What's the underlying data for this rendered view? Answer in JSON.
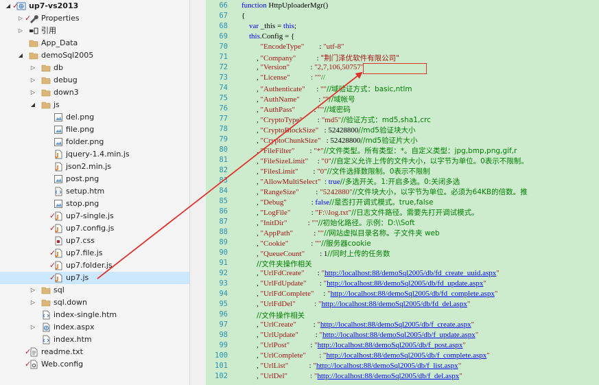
{
  "explorer": {
    "items": [
      {
        "label": "up7-vs2013",
        "depth": 0,
        "icon": "solution",
        "expand": "open",
        "checked": true,
        "root": true
      },
      {
        "label": "Properties",
        "depth": 1,
        "icon": "wrench",
        "expand": "closed",
        "checked": true
      },
      {
        "label": "引用",
        "depth": 1,
        "icon": "references",
        "expand": "closed"
      },
      {
        "label": "App_Data",
        "depth": 1,
        "icon": "folder"
      },
      {
        "label": "demoSql2005",
        "depth": 1,
        "icon": "folder",
        "expand": "open"
      },
      {
        "label": "db",
        "depth": 2,
        "icon": "folder",
        "expand": "closed"
      },
      {
        "label": "debug",
        "depth": 2,
        "icon": "folder",
        "expand": "closed"
      },
      {
        "label": "down3",
        "depth": 2,
        "icon": "folder",
        "expand": "closed"
      },
      {
        "label": "js",
        "depth": 2,
        "icon": "folder",
        "expand": "open"
      },
      {
        "label": "del.png",
        "depth": 3,
        "icon": "image"
      },
      {
        "label": "file.png",
        "depth": 3,
        "icon": "image"
      },
      {
        "label": "folder.png",
        "depth": 3,
        "icon": "image"
      },
      {
        "label": "jquery-1.4.min.js",
        "depth": 3,
        "icon": "js"
      },
      {
        "label": "json2.min.js",
        "depth": 3,
        "icon": "js"
      },
      {
        "label": "post.png",
        "depth": 3,
        "icon": "image"
      },
      {
        "label": "setup.htm",
        "depth": 3,
        "icon": "html"
      },
      {
        "label": "stop.png",
        "depth": 3,
        "icon": "image"
      },
      {
        "label": "up7-single.js",
        "depth": 3,
        "icon": "js",
        "checked": true
      },
      {
        "label": "up7.config.js",
        "depth": 3,
        "icon": "js",
        "checked": true
      },
      {
        "label": "up7.css",
        "depth": 3,
        "icon": "css"
      },
      {
        "label": "up7.file.js",
        "depth": 3,
        "icon": "js",
        "checked": true
      },
      {
        "label": "up7.folder.js",
        "depth": 3,
        "icon": "js",
        "checked": true
      },
      {
        "label": "up7.js",
        "depth": 3,
        "icon": "js",
        "checked": true,
        "selected": true
      },
      {
        "label": "sql",
        "depth": 2,
        "icon": "folder",
        "expand": "closed"
      },
      {
        "label": "sql.down",
        "depth": 2,
        "icon": "folder",
        "expand": "closed"
      },
      {
        "label": "index-single.htm",
        "depth": 2,
        "icon": "html"
      },
      {
        "label": "index.aspx",
        "depth": 2,
        "icon": "aspx",
        "expand": "closed"
      },
      {
        "label": "index.htm",
        "depth": 2,
        "icon": "html"
      },
      {
        "label": "readme.txt",
        "depth": 1,
        "icon": "text",
        "checked": true
      },
      {
        "label": "Web.config",
        "depth": 1,
        "icon": "config",
        "checked": true
      }
    ]
  },
  "editor": {
    "lines": [
      {
        "n": "66",
        "tokens": [
          {
            "t": "function",
            "c": "kw"
          },
          {
            "t": " HttpUploaderMgr()"
          }
        ]
      },
      {
        "n": "67",
        "tokens": [
          {
            "t": "{"
          }
        ]
      },
      {
        "n": "68",
        "tokens": [
          {
            "t": "    "
          },
          {
            "t": "var",
            "c": "kw"
          },
          {
            "t": " _this = "
          },
          {
            "t": "this",
            "c": "kw"
          },
          {
            "t": ";"
          }
        ]
      },
      {
        "n": "69",
        "tokens": [
          {
            "t": "    "
          },
          {
            "t": "this",
            "c": "kw"
          },
          {
            "t": ".Config = {"
          }
        ]
      },
      {
        "n": "70",
        "tokens": [
          {
            "t": "          "
          },
          {
            "t": "\"EncodeType\"",
            "c": "str"
          },
          {
            "t": "        : "
          },
          {
            "t": "\"utf-8\"",
            "c": "str"
          }
        ]
      },
      {
        "n": "71",
        "tokens": [
          {
            "t": "        , "
          },
          {
            "t": "\"Company\"",
            "c": "str"
          },
          {
            "t": "           : "
          },
          {
            "t": "\"荆门泽优软件有限公司\"",
            "c": "str"
          }
        ]
      },
      {
        "n": "72",
        "tokens": [
          {
            "t": "        , "
          },
          {
            "t": "\"Version\"",
            "c": "str"
          },
          {
            "t": "           : "
          },
          {
            "t": "\"2,7,106,50757\"",
            "c": "str"
          }
        ]
      },
      {
        "n": "73",
        "tokens": [
          {
            "t": "        , "
          },
          {
            "t": "\"License\"",
            "c": "str"
          },
          {
            "t": "           : "
          },
          {
            "t": "\"\"",
            "c": "str"
          },
          {
            "t": "//",
            "c": "cmt"
          }
        ]
      },
      {
        "n": "74",
        "tokens": [
          {
            "t": "        , "
          },
          {
            "t": "\"Authenticate\"",
            "c": "str"
          },
          {
            "t": "      : "
          },
          {
            "t": "\"\"",
            "c": "str"
          },
          {
            "t": "//域验证方式：basic,ntlm",
            "c": "cmt"
          }
        ]
      },
      {
        "n": "75",
        "tokens": [
          {
            "t": "        , "
          },
          {
            "t": "\"AuthName\"",
            "c": "str"
          },
          {
            "t": "          : "
          },
          {
            "t": "\"\"",
            "c": "str"
          },
          {
            "t": "//域帐号",
            "c": "cmt"
          }
        ]
      },
      {
        "n": "76",
        "tokens": [
          {
            "t": "        , "
          },
          {
            "t": "\"AuthPass\"",
            "c": "str"
          },
          {
            "t": "          : "
          },
          {
            "t": "\"\"",
            "c": "str"
          },
          {
            "t": "//域密码",
            "c": "cmt"
          }
        ]
      },
      {
        "n": "77",
        "tokens": [
          {
            "t": "        , "
          },
          {
            "t": "\"CryptoType\"",
            "c": "str"
          },
          {
            "t": "        : "
          },
          {
            "t": "\"md5\"",
            "c": "str"
          },
          {
            "t": "//验证方式：md5,sha1,crc",
            "c": "cmt"
          }
        ]
      },
      {
        "n": "78",
        "tokens": [
          {
            "t": "        , "
          },
          {
            "t": "\"CryptoBlockSize\"",
            "c": "str"
          },
          {
            "t": "   : 52428800"
          },
          {
            "t": "//md5验证块大小",
            "c": "cmt"
          }
        ]
      },
      {
        "n": "79",
        "tokens": [
          {
            "t": "        , "
          },
          {
            "t": "\"CryptoChunkSize\"",
            "c": "str"
          },
          {
            "t": "   : 52428800"
          },
          {
            "t": "//md5验证片大小",
            "c": "cmt"
          }
        ]
      },
      {
        "n": "80",
        "tokens": [
          {
            "t": "        , "
          },
          {
            "t": "\"FileFilter\"",
            "c": "str"
          },
          {
            "t": "        : "
          },
          {
            "t": "\"*\"",
            "c": "str"
          },
          {
            "t": "//文件类型。所有类型：*。自定义类型：jpg,bmp,png,gif,r",
            "c": "cmt"
          }
        ]
      },
      {
        "n": "81",
        "tokens": [
          {
            "t": "        , "
          },
          {
            "t": "\"FileSizeLimit\"",
            "c": "str"
          },
          {
            "t": "     : "
          },
          {
            "t": "\"0\"",
            "c": "str"
          },
          {
            "t": "//自定义允许上传的文件大小，以字节为单位。0表示不限制。",
            "c": "cmt"
          }
        ]
      },
      {
        "n": "82",
        "tokens": [
          {
            "t": "        , "
          },
          {
            "t": "\"FilesLimit\"",
            "c": "str"
          },
          {
            "t": "        : "
          },
          {
            "t": "\"0\"",
            "c": "str"
          },
          {
            "t": "//文件选择数限制。0表示不限制",
            "c": "cmt"
          }
        ]
      },
      {
        "n": "83",
        "tokens": [
          {
            "t": "        , "
          },
          {
            "t": "\"AllowMultiSelect\"",
            "c": "str"
          },
          {
            "t": "  : "
          },
          {
            "t": "true",
            "c": "kw"
          },
          {
            "t": "//多选开关。1:开启多选。0:关闭多选",
            "c": "cmt"
          }
        ]
      },
      {
        "n": "84",
        "tokens": [
          {
            "t": "        , "
          },
          {
            "t": "\"RangeSize\"",
            "c": "str"
          },
          {
            "t": "         : "
          },
          {
            "t": "\"5242880\"",
            "c": "str"
          },
          {
            "t": "//文件块大小，以字节为单位。必须为64KB的倍数。推",
            "c": "cmt"
          }
        ]
      },
      {
        "n": "85",
        "tokens": [
          {
            "t": "        , "
          },
          {
            "t": "\"Debug\"",
            "c": "str"
          },
          {
            "t": "             : "
          },
          {
            "t": "false",
            "c": "kw"
          },
          {
            "t": "//是否打开调式模式。true,false",
            "c": "cmt"
          }
        ]
      },
      {
        "n": "86",
        "tokens": [
          {
            "t": "        , "
          },
          {
            "t": "\"LogFile\"",
            "c": "str"
          },
          {
            "t": "           : "
          },
          {
            "t": "\"F:\\\\log.txt\"",
            "c": "str"
          },
          {
            "t": "//日志文件路径。需要先打开调试模式。",
            "c": "cmt"
          }
        ]
      },
      {
        "n": "87",
        "tokens": [
          {
            "t": "        , "
          },
          {
            "t": "\"InitDir\"",
            "c": "str"
          },
          {
            "t": "           : "
          },
          {
            "t": "\"\"",
            "c": "str"
          },
          {
            "t": "//初始化路径。示例：D:\\\\Soft",
            "c": "cmt"
          }
        ]
      },
      {
        "n": "88",
        "tokens": [
          {
            "t": "        , "
          },
          {
            "t": "\"AppPath\"",
            "c": "str"
          },
          {
            "t": "           : "
          },
          {
            "t": "\"\"",
            "c": "str"
          },
          {
            "t": "//网站虚拟目录名称。子文件夹 web",
            "c": "cmt"
          }
        ]
      },
      {
        "n": "89",
        "tokens": [
          {
            "t": "        , "
          },
          {
            "t": "\"Cookie\"",
            "c": "str"
          },
          {
            "t": "            : "
          },
          {
            "t": "\"\"",
            "c": "str"
          },
          {
            "t": "//服务器cookie",
            "c": "cmt"
          }
        ]
      },
      {
        "n": "90",
        "tokens": [
          {
            "t": "        , "
          },
          {
            "t": "\"QueueCount\"",
            "c": "str"
          },
          {
            "t": "        : 1"
          },
          {
            "t": "//同时上传的任务数",
            "c": "cmt"
          }
        ]
      },
      {
        "n": "91",
        "tokens": [
          {
            "t": "        "
          },
          {
            "t": "//文件夹操作相关",
            "c": "cmt"
          }
        ]
      },
      {
        "n": "92",
        "tokens": [
          {
            "t": "        , "
          },
          {
            "t": "\"UrlFdCreate\"",
            "c": "str"
          },
          {
            "t": "       : "
          },
          {
            "t": "\"",
            "c": "str"
          },
          {
            "t": "http://localhost:88/demoSql2005/db/fd_create_uuid.aspx",
            "c": "url"
          },
          {
            "t": "\"",
            "c": "str"
          }
        ]
      },
      {
        "n": "93",
        "tokens": [
          {
            "t": "        , "
          },
          {
            "t": "\"UrlFdUpdate\"",
            "c": "str"
          },
          {
            "t": "       : "
          },
          {
            "t": "\"",
            "c": "str"
          },
          {
            "t": "http://localhost:88/demoSql2005/db/fd_update.aspx",
            "c": "url"
          },
          {
            "t": "\"",
            "c": "str"
          }
        ]
      },
      {
        "n": "94",
        "tokens": [
          {
            "t": "        , "
          },
          {
            "t": "\"UrlFdComplete\"",
            "c": "str"
          },
          {
            "t": "     : "
          },
          {
            "t": "\"",
            "c": "str"
          },
          {
            "t": "http://localhost:88/demoSql2005/db/fd_complete.aspx",
            "c": "url"
          },
          {
            "t": "\"",
            "c": "str"
          }
        ]
      },
      {
        "n": "95",
        "tokens": [
          {
            "t": "        , "
          },
          {
            "t": "\"UrlFdDel\"",
            "c": "str"
          },
          {
            "t": "          : "
          },
          {
            "t": "\"",
            "c": "str"
          },
          {
            "t": "http://localhost:88/demoSql2005/db/fd_del.aspx",
            "c": "url"
          },
          {
            "t": "\"",
            "c": "str"
          }
        ]
      },
      {
        "n": "96",
        "tokens": [
          {
            "t": "        "
          },
          {
            "t": "//文件操作相关",
            "c": "cmt"
          }
        ]
      },
      {
        "n": "97",
        "tokens": [
          {
            "t": "        , "
          },
          {
            "t": "\"UrlCreate\"",
            "c": "str"
          },
          {
            "t": "         : "
          },
          {
            "t": "\"",
            "c": "str"
          },
          {
            "t": "http://localhost:88/demoSql2005/db/f_create.aspx",
            "c": "url"
          },
          {
            "t": "\"",
            "c": "str"
          }
        ]
      },
      {
        "n": "98",
        "tokens": [
          {
            "t": "        , "
          },
          {
            "t": "\"UrlUpdate\"",
            "c": "str"
          },
          {
            "t": "         : "
          },
          {
            "t": "\"",
            "c": "str"
          },
          {
            "t": "http://localhost:88/demoSql2005/db/f_update.aspx",
            "c": "url"
          },
          {
            "t": "\"",
            "c": "str"
          }
        ]
      },
      {
        "n": "99",
        "tokens": [
          {
            "t": "        , "
          },
          {
            "t": "\"UrlPost\"",
            "c": "str"
          },
          {
            "t": "           : "
          },
          {
            "t": "\"",
            "c": "str"
          },
          {
            "t": "http://localhost:88/demoSql2005/db/f_post.aspx",
            "c": "url"
          },
          {
            "t": "\"",
            "c": "str"
          }
        ]
      },
      {
        "n": "100",
        "tokens": [
          {
            "t": "        , "
          },
          {
            "t": "\"UrlComplete\"",
            "c": "str"
          },
          {
            "t": "       : "
          },
          {
            "t": "\"",
            "c": "str"
          },
          {
            "t": "http://localhost:88/demoSql2005/db/f_complete.aspx",
            "c": "url"
          },
          {
            "t": "\"",
            "c": "str"
          }
        ]
      },
      {
        "n": "101",
        "tokens": [
          {
            "t": "        , "
          },
          {
            "t": "\"UrlList\"",
            "c": "str"
          },
          {
            "t": "           : "
          },
          {
            "t": "\"",
            "c": "str"
          },
          {
            "t": "http://localhost:88/demoSql2005/db/f_list.aspx",
            "c": "url"
          },
          {
            "t": "\"",
            "c": "str"
          }
        ]
      },
      {
        "n": "102",
        "tokens": [
          {
            "t": "        , "
          },
          {
            "t": "\"UrlDel\"",
            "c": "str"
          },
          {
            "t": "            : "
          },
          {
            "t": "\"",
            "c": "str"
          },
          {
            "t": "http://localhost:88/demoSql2005/db/f_del.aspx",
            "c": "url"
          },
          {
            "t": "\"",
            "c": "str"
          }
        ]
      }
    ]
  },
  "annotation": {
    "color": "#e0322d"
  }
}
